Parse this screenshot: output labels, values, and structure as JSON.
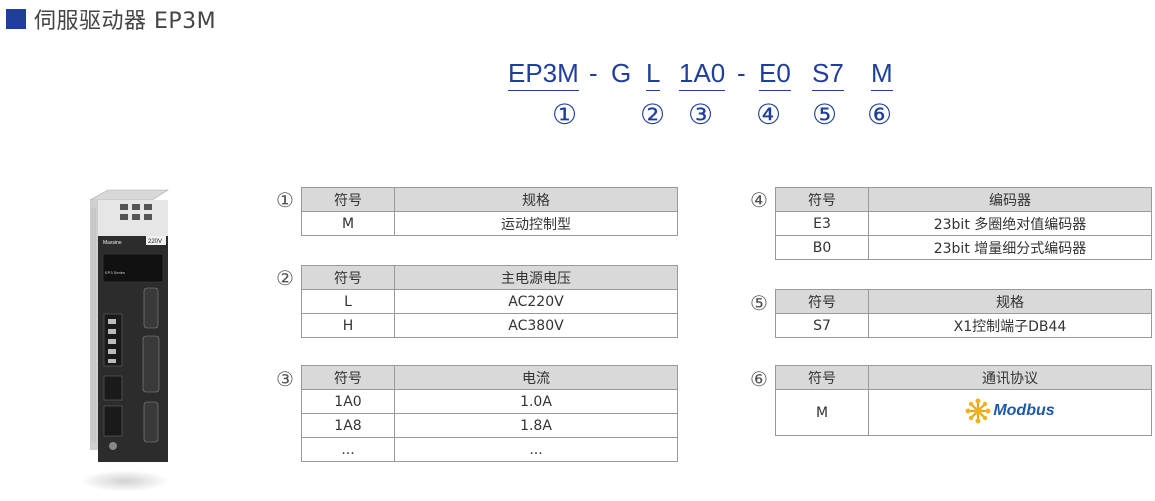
{
  "title": "伺服驱动器 EP3M",
  "code_parts": [
    {
      "text": "EP3M",
      "underline": true
    },
    {
      "text": "-",
      "underline": false
    },
    {
      "text": "G",
      "underline": false
    },
    {
      "text": "L",
      "underline": true
    },
    {
      "text": "1A0",
      "underline": true
    },
    {
      "text": "-",
      "underline": false
    },
    {
      "text": "E0",
      "underline": true
    },
    {
      "text": "S7",
      "underline": true
    },
    {
      "text": "M",
      "underline": true
    }
  ],
  "markers": [
    "①",
    "②",
    "③",
    "④",
    "⑤",
    "⑥"
  ],
  "tables": {
    "t1": {
      "num": "①",
      "h1": "符号",
      "h2": "规格",
      "rows": [
        [
          "M",
          "运动控制型"
        ]
      ]
    },
    "t2": {
      "num": "②",
      "h1": "符号",
      "h2": "主电源电压",
      "rows": [
        [
          "L",
          "AC220V"
        ],
        [
          "H",
          "AC380V"
        ]
      ]
    },
    "t3": {
      "num": "③",
      "h1": "符号",
      "h2": "电流",
      "rows": [
        [
          "1A0",
          "1.0A"
        ],
        [
          "1A8",
          "1.8A"
        ],
        [
          "...",
          "..."
        ]
      ]
    },
    "t4": {
      "num": "④",
      "h1": "符号",
      "h2": "编码器",
      "rows": [
        [
          "E3",
          "23bit 多圈绝对值编码器"
        ],
        [
          "B0",
          "23bit 增量细分式编码器"
        ]
      ]
    },
    "t5": {
      "num": "⑤",
      "h1": "符号",
      "h2": "规格",
      "rows": [
        [
          "S7",
          "X1控制端子DB44"
        ]
      ]
    },
    "t6": {
      "num": "⑥",
      "h1": "符号",
      "h2": "通讯协议",
      "rows": [
        [
          "M",
          "Modbus"
        ]
      ]
    }
  },
  "device": {
    "brand": "Maxsine",
    "voltage_badge": "220V",
    "model": "EP3 Series"
  },
  "colors": {
    "accent": "#1f3f9a",
    "header_bg": "#d9d9d9",
    "border": "#999999"
  }
}
